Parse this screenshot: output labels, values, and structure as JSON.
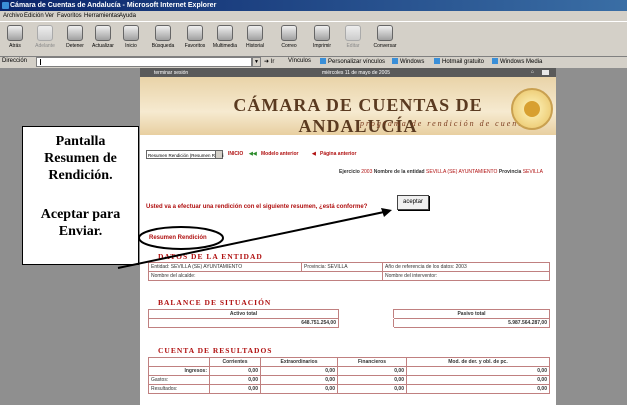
{
  "window": {
    "title": "Cámara de Cuentas de Andalucía - Microsoft Internet Explorer"
  },
  "menu": [
    "Archivo",
    "Edición",
    "Ver",
    "Favoritos",
    "Herramientas",
    "Ayuda"
  ],
  "toolbar": [
    {
      "label": "Atrás",
      "icon": "back-arrow-icon",
      "disabled": false
    },
    {
      "label": "Adelante",
      "icon": "forward-arrow-icon",
      "disabled": true
    },
    {
      "label": "Detener",
      "icon": "stop-icon",
      "disabled": false
    },
    {
      "label": "Actualizar",
      "icon": "refresh-icon",
      "disabled": false
    },
    {
      "label": "Inicio",
      "icon": "home-icon",
      "disabled": false
    },
    {
      "label": "Búsqueda",
      "icon": "search-icon",
      "disabled": false
    },
    {
      "label": "Favoritos",
      "icon": "favorites-icon",
      "disabled": false
    },
    {
      "label": "Multimedia",
      "icon": "media-icon",
      "disabled": false
    },
    {
      "label": "Historial",
      "icon": "history-icon",
      "disabled": false
    },
    {
      "label": "Correo",
      "icon": "mail-icon",
      "disabled": false
    },
    {
      "label": "Imprimir",
      "icon": "print-icon",
      "disabled": false
    },
    {
      "label": "Editar",
      "icon": "edit-icon",
      "disabled": true
    },
    {
      "label": "Conversar",
      "icon": "discuss-icon",
      "disabled": false
    }
  ],
  "addressbar": {
    "label": "Dirección",
    "value": "",
    "go": "Ir",
    "links": [
      "Vínculos",
      "Personalizar vínculos",
      "Windows",
      "Hotmail gratuito",
      "Windows Media"
    ]
  },
  "site": {
    "top_left": "terminar sesión",
    "top_date": "miércoles 11 de mayo de 2005",
    "banner_name": "CÁMARA DE CUENTAS DE ANDALUCÍA",
    "banner_sub": "programa de rendición de cuentas",
    "select_value": "Resumen Rendición (Resumen Rendi",
    "nav": {
      "inicio": "INICIO",
      "modelo": "Modelo anterior",
      "pagina": "Página anterior"
    },
    "ejercicio_label": "Ejercicio",
    "ejercicio_value": "2003",
    "entidad_label": "Nombre de la entidad",
    "entidad_value": "SEVILLA (SE) AYUNTAMIENTO",
    "provincia_label": "Provincia",
    "provincia_value": "SEVILLA",
    "question": "Usted va a efectuar una rendición con el siguiente resumen, ¿está conforme?",
    "accept": "aceptar",
    "resumen": "Resumen Rendición"
  },
  "datos": {
    "heading": "DATOS DE LA ENTIDAD",
    "entidad": "Entidad: SEVILLA (SE) AYUNTAMIENTO",
    "provincia": "Provincia: SEVILLA",
    "anio": "Año de referencia de los datos: 2003",
    "alcalde": "Nombre del alcalde:",
    "interventor": "Nombre del interventor:"
  },
  "balance": {
    "heading": "BALANCE DE SITUACIÓN",
    "activo_label": "Activo total",
    "pasivo_label": "Pasivo total",
    "activo_value": "648.751.254,00",
    "pasivo_value": "5.987.564.287,00"
  },
  "resultados": {
    "heading": "CUENTA DE RESULTADOS",
    "columns": [
      "",
      "Corrientes",
      "Extraordinarios",
      "Financieros",
      "Mod. de der. y obl. de pc."
    ],
    "rows": [
      {
        "label": "Ingresos:",
        "values": [
          "0,00",
          "0,00",
          "0,00",
          "0,00"
        ]
      },
      {
        "label": "Gastos:",
        "values": [
          "0,00",
          "0,00",
          "0,00",
          "0,00"
        ]
      },
      {
        "label": "Resultados:",
        "values": [
          "0,00",
          "0,00",
          "0,00",
          "0,00"
        ]
      }
    ]
  },
  "callout": {
    "line1": "Pantalla",
    "line2": "Resumen de",
    "line3": "Rendición.",
    "line4": "Aceptar para",
    "line5": "Enviar."
  }
}
